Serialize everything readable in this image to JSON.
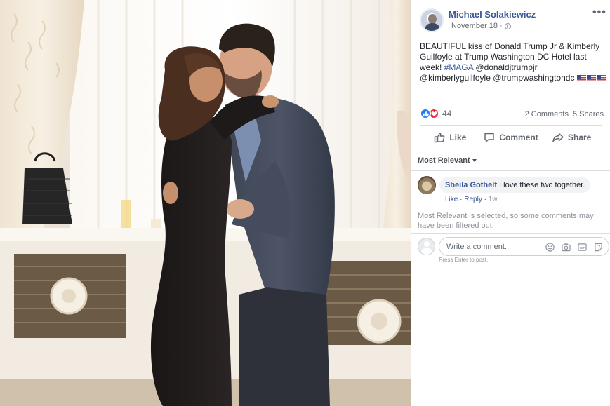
{
  "post": {
    "author": "Michael Solakiewicz",
    "date": "November 18",
    "more_label": "•••",
    "text_main": "BEAUTIFUL kiss of Donald Trump Jr & Kimberly Guilfoyle at Trump Washington DC Hotel last week! ",
    "hashtag": "#MAGA",
    "text_tail": " @donaldjtrumpjr @kimberlyguilfoyle @trumpwashingtondc ",
    "flags": [
      "us-flag-icon",
      "us-flag-icon",
      "us-flag-icon"
    ]
  },
  "stats": {
    "reaction_count": "44",
    "comments": "2 Comments",
    "shares": "5 Shares",
    "reaction_icons": [
      "like-reaction-icon",
      "love-reaction-icon"
    ]
  },
  "actions": {
    "like": "Like",
    "comment": "Comment",
    "share": "Share"
  },
  "comments": {
    "sort_label": "Most Relevant",
    "items": [
      {
        "author": "Sheila Gothelf",
        "text": "I love these two together.",
        "like": "Like",
        "reply": "Reply",
        "time": "1w"
      }
    ],
    "filtered_note": "Most Relevant is selected, so some comments may have been filtered out."
  },
  "composer": {
    "placeholder": "Write a comment...",
    "hint": "Press Enter to post.",
    "icons": [
      "emoji-icon",
      "camera-icon",
      "gif-icon",
      "sticker-icon"
    ]
  },
  "colors": {
    "link": "#385898",
    "like_blue": "#2078f4",
    "love_red": "#f0284a",
    "muted": "#606770"
  }
}
